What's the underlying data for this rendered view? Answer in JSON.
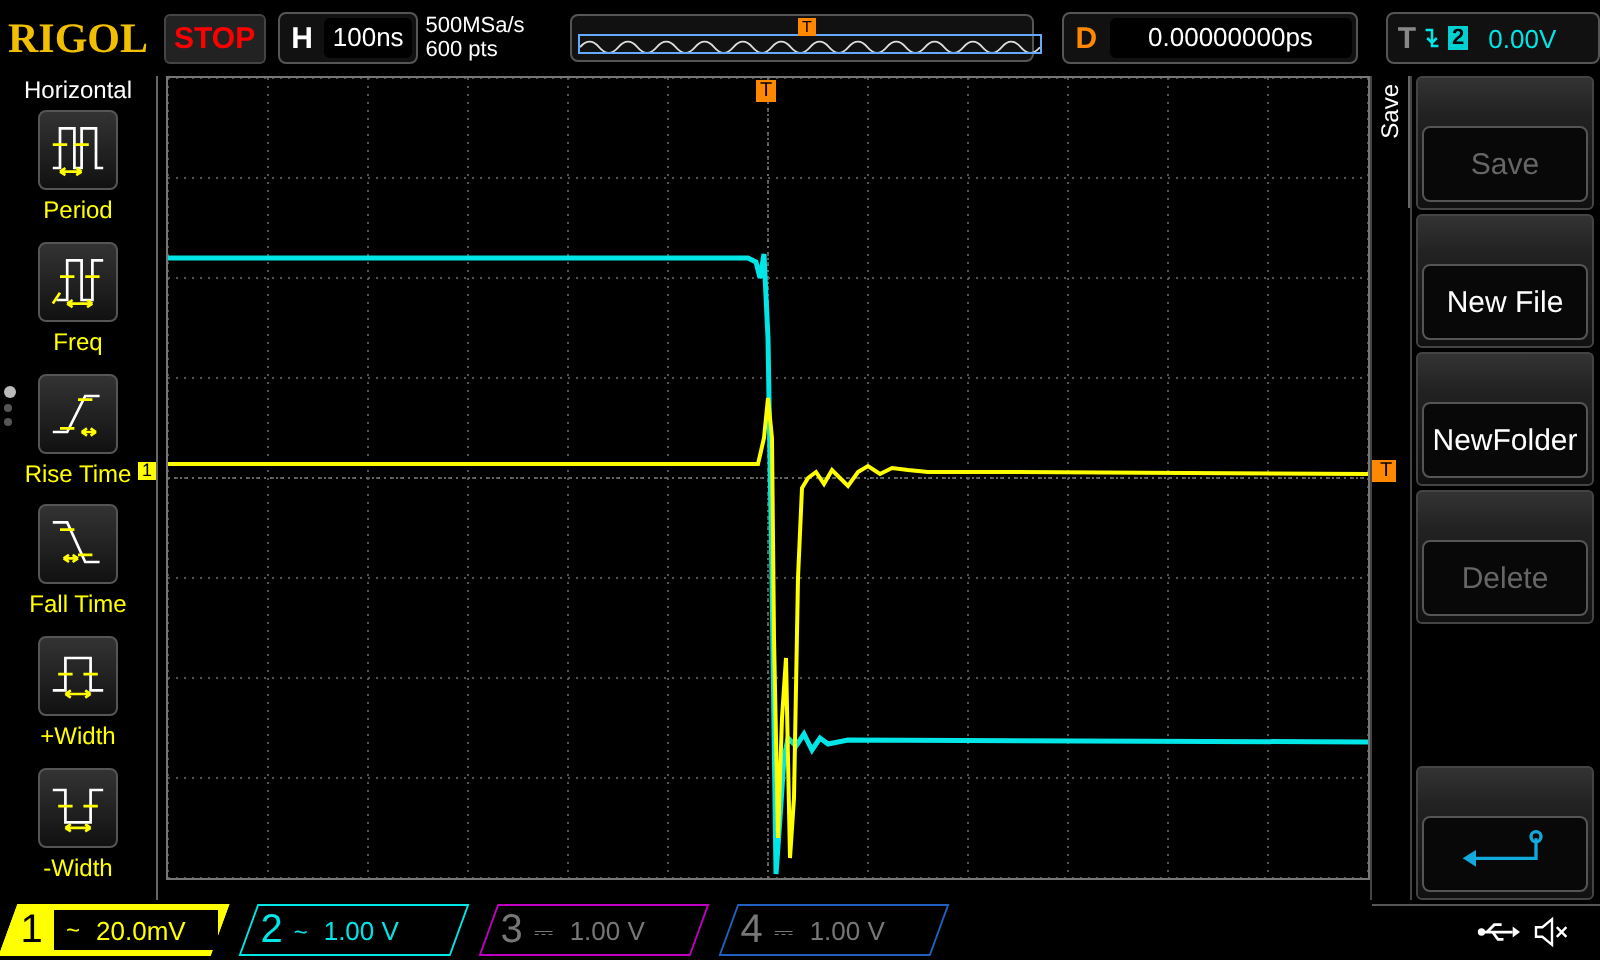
{
  "brand": "RIGOL",
  "run_state": "STOP",
  "timebase": {
    "label": "H",
    "value": "100ns"
  },
  "sample_rate": "500MSa/s",
  "memory_depth": "600 pts",
  "memory_trigger_label": "T",
  "delay": {
    "label": "D",
    "value": "0.00000000ps"
  },
  "trigger": {
    "label": "T",
    "source": "2",
    "level": "0.00V"
  },
  "left_menu": {
    "title": "Horizontal",
    "items": [
      {
        "kind": "period",
        "label": "Period"
      },
      {
        "kind": "freq",
        "label": "Freq"
      },
      {
        "kind": "rise",
        "label": "Rise Time"
      },
      {
        "kind": "fall",
        "label": "Fall Time"
      },
      {
        "kind": "pwidth",
        "label": "+Width"
      },
      {
        "kind": "nwidth",
        "label": "-Width"
      }
    ],
    "page_dots": [
      {
        "selected": true
      },
      {
        "selected": false
      },
      {
        "selected": false
      }
    ]
  },
  "markers": {
    "channel_label": "1",
    "trigger_label": "T",
    "trigger_top_label": "T"
  },
  "right_menu": {
    "title": "Save",
    "buttons": [
      {
        "kind": "text",
        "label": "Save",
        "disabled": true
      },
      {
        "kind": "text",
        "label": "New File",
        "disabled": false
      },
      {
        "kind": "text",
        "label": "NewFolder",
        "disabled": false
      },
      {
        "kind": "text",
        "label": "Delete",
        "disabled": true
      },
      {
        "kind": "back"
      }
    ]
  },
  "channels": [
    {
      "number": "1",
      "coupling": "~",
      "scale": "20.0mV",
      "color": "#ffff00",
      "on": true
    },
    {
      "number": "2",
      "coupling": "~",
      "scale": "1.00 V",
      "color": "#00e5e5",
      "on": true
    },
    {
      "number": "3",
      "coupling": "⎓",
      "scale": "1.00 V",
      "color": "#c000c0",
      "on": false
    },
    {
      "number": "4",
      "coupling": "⎓",
      "scale": "1.00 V",
      "color": "#2060c0",
      "on": false
    }
  ]
}
